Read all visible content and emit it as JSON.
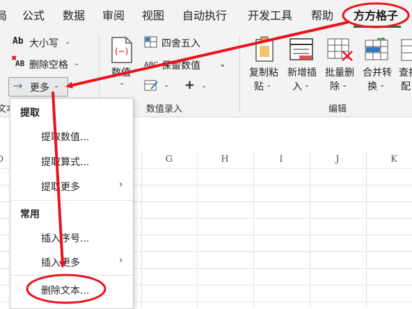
{
  "menu": {
    "tab_partial": "局",
    "tabs": [
      "公式",
      "数据",
      "审阅",
      "视图",
      "自动执行",
      "开发工具",
      "帮助"
    ],
    "active_tab": "方方格子"
  },
  "ribbon": {
    "text_group": {
      "case_label": "大小写",
      "remove_space_label": "删除空格",
      "more_label": "更多",
      "group_label_partial": "文本"
    },
    "number_group": {
      "number_label": "数值",
      "round_label": "四舍五入",
      "keep_number_label": "保留数值",
      "plus_label": "+",
      "group_label": "数值录入"
    },
    "edit_group": {
      "buttons": [
        {
          "line1": "复制粘",
          "line2": "贴"
        },
        {
          "line1": "新增插",
          "line2": "入"
        },
        {
          "line1": "批量删",
          "line2": "除"
        },
        {
          "line1": "合并转",
          "line2": "换"
        },
        {
          "line1": "查找",
          "line2": "配"
        }
      ],
      "group_label": "编辑"
    }
  },
  "sheet": {
    "columns": [
      "D",
      "G",
      "H",
      "I",
      "J",
      "K"
    ]
  },
  "dropdown": {
    "section1_title": "提取",
    "item_extract_value": "提取数值...",
    "item_extract_formula": "提取算式...",
    "item_extract_more": "提取更多",
    "section2_title": "常用",
    "item_insert_seq": "插入序号...",
    "item_insert_more": "插入更多",
    "item_delete_text": "删除文本..."
  },
  "colors": {
    "annotation": "#e8131b",
    "accent": "#1e7145",
    "icon_blue": "#2b79c2"
  }
}
